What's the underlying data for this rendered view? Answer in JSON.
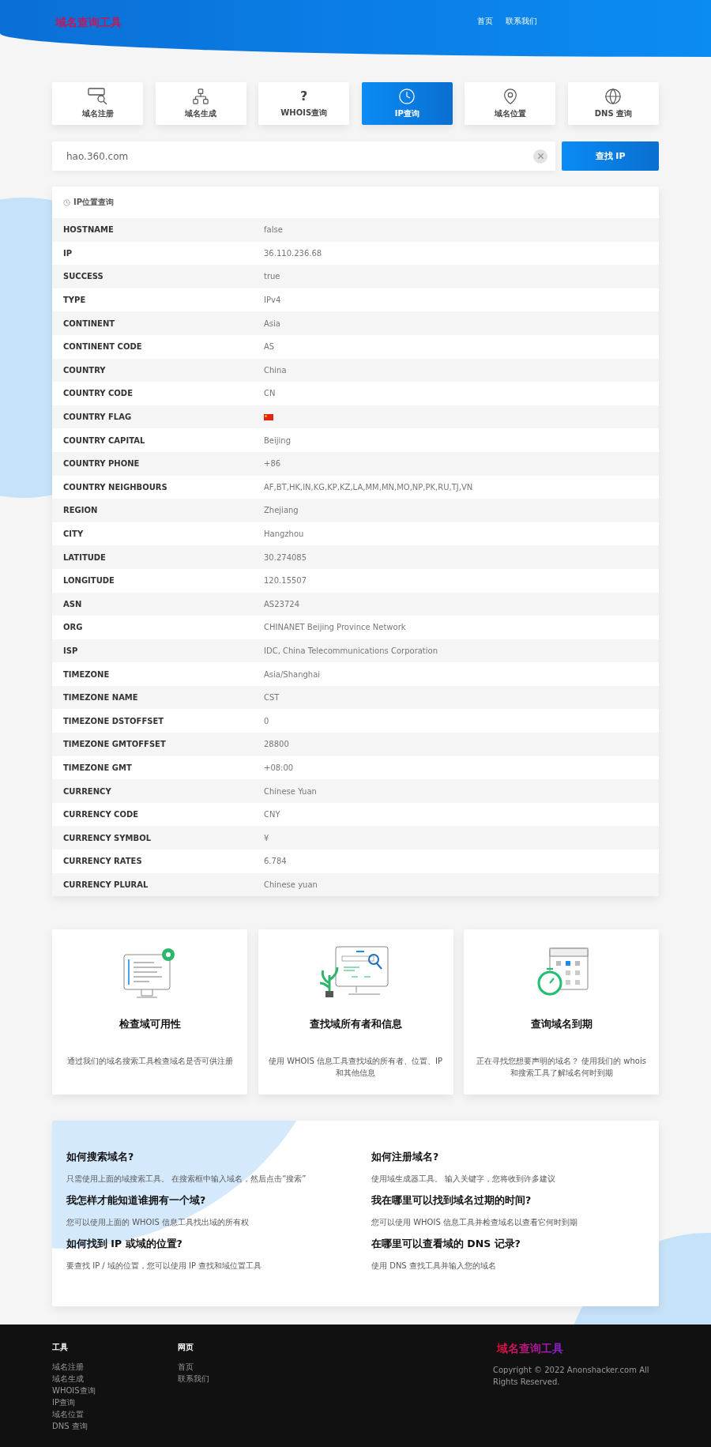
{
  "header": {
    "logo": "域名查询工具",
    "nav": [
      "首页",
      "联系我们"
    ]
  },
  "tabs": [
    {
      "label": "域名注册",
      "selected": false
    },
    {
      "label": "域名生成",
      "selected": false
    },
    {
      "label": "WHOIS查询",
      "selected": false,
      "glyph": "?"
    },
    {
      "label": "IP查询",
      "selected": true
    },
    {
      "label": "域名位置",
      "selected": false
    },
    {
      "label": "DNS 查询",
      "selected": false
    }
  ],
  "search": {
    "value": "hao.360.com",
    "button": "查找 IP"
  },
  "result": {
    "title": "IP位置查询",
    "rows": [
      {
        "label": "HOSTNAME",
        "value": "false",
        "kind": "text"
      },
      {
        "label": "IP",
        "value": "36.110.236.68",
        "kind": "text"
      },
      {
        "label": "SUCCESS",
        "value": "true",
        "kind": "text"
      },
      {
        "label": "TYPE",
        "value": "IPv4",
        "kind": "text"
      },
      {
        "label": "CONTINENT",
        "value": "Asia",
        "kind": "text"
      },
      {
        "label": "CONTINENT CODE",
        "value": "AS",
        "kind": "text"
      },
      {
        "label": "COUNTRY",
        "value": "China",
        "kind": "text"
      },
      {
        "label": "COUNTRY CODE",
        "value": "CN",
        "kind": "text"
      },
      {
        "label": "COUNTRY FLAG",
        "kind": "flag"
      },
      {
        "label": "COUNTRY CAPITAL",
        "value": "Beijing",
        "kind": "text"
      },
      {
        "label": "COUNTRY PHONE",
        "value": "+86",
        "kind": "text"
      },
      {
        "label": "COUNTRY NEIGHBOURS",
        "value": "AF,BT,HK,IN,KG,KP,KZ,LA,MM,MN,MO,NP,PK,RU,TJ,VN",
        "kind": "text"
      },
      {
        "label": "REGION",
        "value": "Zhejiang",
        "kind": "text"
      },
      {
        "label": "CITY",
        "value": "Hangzhou",
        "kind": "text"
      },
      {
        "label": "LATITUDE",
        "value": "30.274085",
        "kind": "text"
      },
      {
        "label": "LONGITUDE",
        "value": "120.15507",
        "kind": "text"
      },
      {
        "label": "ASN",
        "value": "AS23724",
        "kind": "text"
      },
      {
        "label": "ORG",
        "value": "CHINANET Beijing Province Network",
        "kind": "text"
      },
      {
        "label": "ISP",
        "value": "IDC, China Telecommunications Corporation",
        "kind": "text"
      },
      {
        "label": "TIMEZONE",
        "value": "Asia/Shanghai",
        "kind": "text"
      },
      {
        "label": "TIMEZONE NAME",
        "value": "CST",
        "kind": "text"
      },
      {
        "label": "TIMEZONE DSTOFFSET",
        "value": "0",
        "kind": "text"
      },
      {
        "label": "TIMEZONE GMTOFFSET",
        "value": "28800",
        "kind": "text"
      },
      {
        "label": "TIMEZONE GMT",
        "value": "+08:00",
        "kind": "text"
      },
      {
        "label": "CURRENCY",
        "value": "Chinese Yuan",
        "kind": "text"
      },
      {
        "label": "CURRENCY CODE",
        "value": "CNY",
        "kind": "text"
      },
      {
        "label": "CURRENCY SYMBOL",
        "value": "¥",
        "kind": "text"
      },
      {
        "label": "CURRENCY RATES",
        "value": "6.784",
        "kind": "text"
      },
      {
        "label": "CURRENCY PLURAL",
        "value": "Chinese yuan",
        "kind": "text"
      }
    ]
  },
  "features": [
    {
      "title": "检查域可用性",
      "text": "通过我们的域名搜索工具检查域名是否可供注册"
    },
    {
      "title": "查找域所有者和信息",
      "text": "使用 WHOIS 信息工具查找域的所有者、位置、IP 和其他信息"
    },
    {
      "title": "查询域名到期",
      "text": "正在寻找您想要声明的域名？ 使用我们的 whois 和搜索工具了解域名何时到期"
    }
  ],
  "faq": [
    {
      "question": "如何搜索域名?",
      "answer": "只需使用上面的域搜索工具。 在搜索框中输入域名，然后点击“搜索”"
    },
    {
      "question": "如何注册域名?",
      "answer": "使用域生成器工具。 输入关键字，您将收到许多建议"
    },
    {
      "question": "我怎样才能知道谁拥有一个域?",
      "answer": "您可以使用上面的 WHOIS 信息工具找出域的所有权"
    },
    {
      "question": "我在哪里可以找到域名过期的时间?",
      "answer": "您可以使用 WHOIS 信息工具并检查域名以查看它何时到期"
    },
    {
      "question": "如何找到 IP 或域的位置?",
      "answer": "要查找 IP / 域的位置，您可以使用 IP 查找和域位置工具"
    },
    {
      "question": "在哪里可以查看域的 DNS 记录?",
      "answer": "使用 DNS 查找工具并输入您的域名"
    }
  ],
  "footer": {
    "columns": [
      {
        "title": "工具",
        "links": [
          "域名注册",
          "域名生成",
          "WHOIS查询",
          "IP查询",
          "域名位置",
          "DNS 查询"
        ]
      },
      {
        "title": "网页",
        "links": [
          "首页",
          "联系我们"
        ]
      }
    ],
    "brand": "域名查询工具",
    "copyright": "Copyright © 2022 Anonshacker.com All Rights Reserved."
  }
}
